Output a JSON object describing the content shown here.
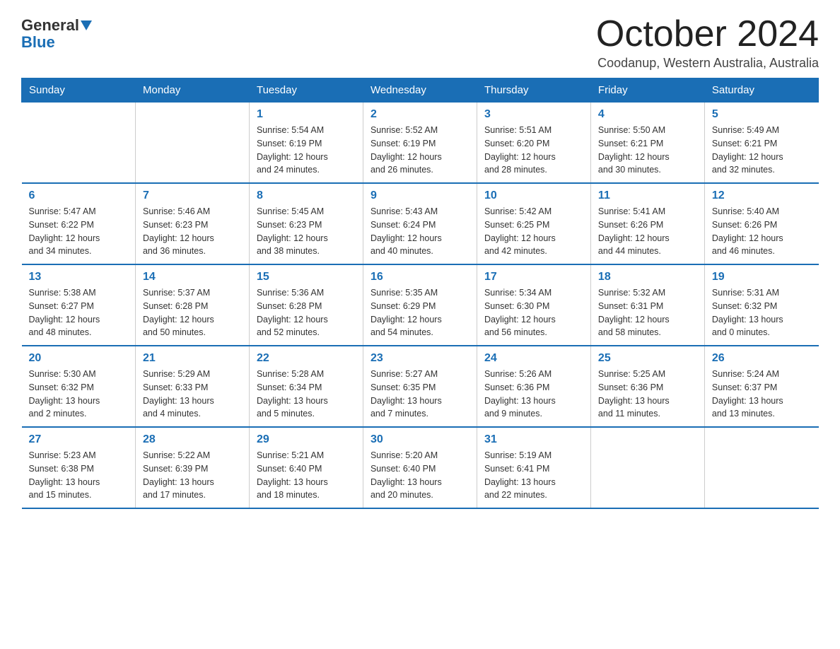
{
  "logo": {
    "text1": "General",
    "text2": "Blue"
  },
  "header": {
    "title": "October 2024",
    "subtitle": "Coodanup, Western Australia, Australia"
  },
  "weekdays": [
    "Sunday",
    "Monday",
    "Tuesday",
    "Wednesday",
    "Thursday",
    "Friday",
    "Saturday"
  ],
  "weeks": [
    [
      {
        "day": "",
        "info": ""
      },
      {
        "day": "",
        "info": ""
      },
      {
        "day": "1",
        "info": "Sunrise: 5:54 AM\nSunset: 6:19 PM\nDaylight: 12 hours\nand 24 minutes."
      },
      {
        "day": "2",
        "info": "Sunrise: 5:52 AM\nSunset: 6:19 PM\nDaylight: 12 hours\nand 26 minutes."
      },
      {
        "day": "3",
        "info": "Sunrise: 5:51 AM\nSunset: 6:20 PM\nDaylight: 12 hours\nand 28 minutes."
      },
      {
        "day": "4",
        "info": "Sunrise: 5:50 AM\nSunset: 6:21 PM\nDaylight: 12 hours\nand 30 minutes."
      },
      {
        "day": "5",
        "info": "Sunrise: 5:49 AM\nSunset: 6:21 PM\nDaylight: 12 hours\nand 32 minutes."
      }
    ],
    [
      {
        "day": "6",
        "info": "Sunrise: 5:47 AM\nSunset: 6:22 PM\nDaylight: 12 hours\nand 34 minutes."
      },
      {
        "day": "7",
        "info": "Sunrise: 5:46 AM\nSunset: 6:23 PM\nDaylight: 12 hours\nand 36 minutes."
      },
      {
        "day": "8",
        "info": "Sunrise: 5:45 AM\nSunset: 6:23 PM\nDaylight: 12 hours\nand 38 minutes."
      },
      {
        "day": "9",
        "info": "Sunrise: 5:43 AM\nSunset: 6:24 PM\nDaylight: 12 hours\nand 40 minutes."
      },
      {
        "day": "10",
        "info": "Sunrise: 5:42 AM\nSunset: 6:25 PM\nDaylight: 12 hours\nand 42 minutes."
      },
      {
        "day": "11",
        "info": "Sunrise: 5:41 AM\nSunset: 6:26 PM\nDaylight: 12 hours\nand 44 minutes."
      },
      {
        "day": "12",
        "info": "Sunrise: 5:40 AM\nSunset: 6:26 PM\nDaylight: 12 hours\nand 46 minutes."
      }
    ],
    [
      {
        "day": "13",
        "info": "Sunrise: 5:38 AM\nSunset: 6:27 PM\nDaylight: 12 hours\nand 48 minutes."
      },
      {
        "day": "14",
        "info": "Sunrise: 5:37 AM\nSunset: 6:28 PM\nDaylight: 12 hours\nand 50 minutes."
      },
      {
        "day": "15",
        "info": "Sunrise: 5:36 AM\nSunset: 6:28 PM\nDaylight: 12 hours\nand 52 minutes."
      },
      {
        "day": "16",
        "info": "Sunrise: 5:35 AM\nSunset: 6:29 PM\nDaylight: 12 hours\nand 54 minutes."
      },
      {
        "day": "17",
        "info": "Sunrise: 5:34 AM\nSunset: 6:30 PM\nDaylight: 12 hours\nand 56 minutes."
      },
      {
        "day": "18",
        "info": "Sunrise: 5:32 AM\nSunset: 6:31 PM\nDaylight: 12 hours\nand 58 minutes."
      },
      {
        "day": "19",
        "info": "Sunrise: 5:31 AM\nSunset: 6:32 PM\nDaylight: 13 hours\nand 0 minutes."
      }
    ],
    [
      {
        "day": "20",
        "info": "Sunrise: 5:30 AM\nSunset: 6:32 PM\nDaylight: 13 hours\nand 2 minutes."
      },
      {
        "day": "21",
        "info": "Sunrise: 5:29 AM\nSunset: 6:33 PM\nDaylight: 13 hours\nand 4 minutes."
      },
      {
        "day": "22",
        "info": "Sunrise: 5:28 AM\nSunset: 6:34 PM\nDaylight: 13 hours\nand 5 minutes."
      },
      {
        "day": "23",
        "info": "Sunrise: 5:27 AM\nSunset: 6:35 PM\nDaylight: 13 hours\nand 7 minutes."
      },
      {
        "day": "24",
        "info": "Sunrise: 5:26 AM\nSunset: 6:36 PM\nDaylight: 13 hours\nand 9 minutes."
      },
      {
        "day": "25",
        "info": "Sunrise: 5:25 AM\nSunset: 6:36 PM\nDaylight: 13 hours\nand 11 minutes."
      },
      {
        "day": "26",
        "info": "Sunrise: 5:24 AM\nSunset: 6:37 PM\nDaylight: 13 hours\nand 13 minutes."
      }
    ],
    [
      {
        "day": "27",
        "info": "Sunrise: 5:23 AM\nSunset: 6:38 PM\nDaylight: 13 hours\nand 15 minutes."
      },
      {
        "day": "28",
        "info": "Sunrise: 5:22 AM\nSunset: 6:39 PM\nDaylight: 13 hours\nand 17 minutes."
      },
      {
        "day": "29",
        "info": "Sunrise: 5:21 AM\nSunset: 6:40 PM\nDaylight: 13 hours\nand 18 minutes."
      },
      {
        "day": "30",
        "info": "Sunrise: 5:20 AM\nSunset: 6:40 PM\nDaylight: 13 hours\nand 20 minutes."
      },
      {
        "day": "31",
        "info": "Sunrise: 5:19 AM\nSunset: 6:41 PM\nDaylight: 13 hours\nand 22 minutes."
      },
      {
        "day": "",
        "info": ""
      },
      {
        "day": "",
        "info": ""
      }
    ]
  ]
}
